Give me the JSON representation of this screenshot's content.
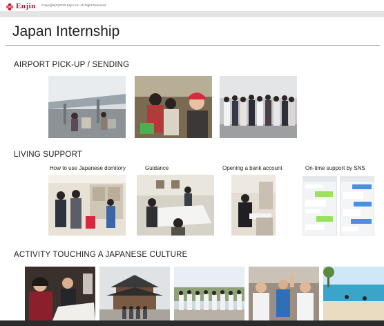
{
  "header": {
    "brand": "Enjin",
    "copyright": "Copyright(C)2019 Enjin Inc. All Right Reserved",
    "brand_color": "#b0102e"
  },
  "page": {
    "title": "Japan Internship"
  },
  "sections": {
    "airport": {
      "heading": "AIRPORT PICK-UP / SENDING"
    },
    "living": {
      "heading": "LIVING SUPPORT",
      "captions": [
        "How to use Japanese domitory",
        "Guidance",
        "Opening a bank account",
        "On-time support by SNS"
      ]
    },
    "culture": {
      "heading": "ACTIVITY TOUCHING A JAPANESE CULTURE"
    }
  },
  "icons": {
    "logo": "enjin-flower-logo"
  }
}
